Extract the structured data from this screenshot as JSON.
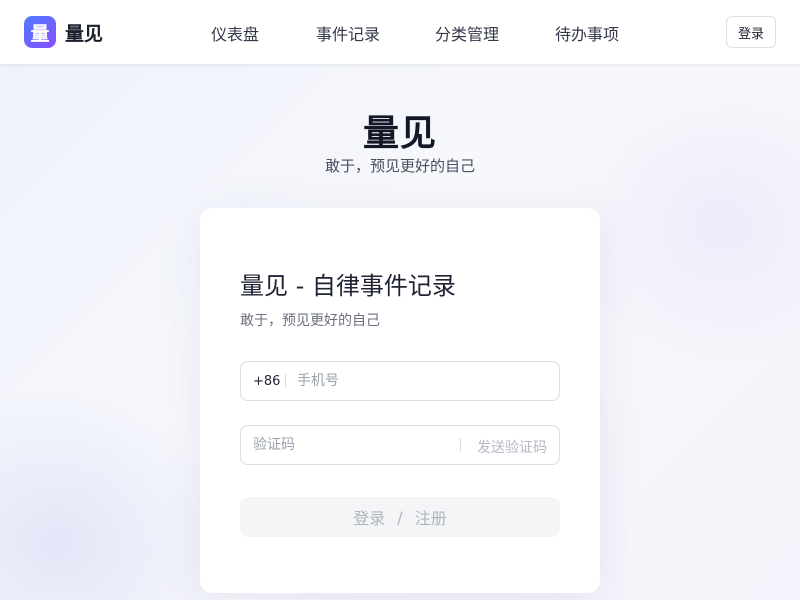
{
  "header": {
    "logo_char": "量",
    "brand_name": "量见",
    "nav": [
      "仪表盘",
      "事件记录",
      "分类管理",
      "待办事项"
    ],
    "login_label": "登录"
  },
  "hero": {
    "title": "量见",
    "subtitle": "敢于，预见更好的自己"
  },
  "card": {
    "title": "量见 - 自律事件记录",
    "subtitle": "敢于，预见更好的自己",
    "phone": {
      "prefix": "+86",
      "placeholder": "手机号",
      "value": ""
    },
    "code": {
      "placeholder": "验证码",
      "value": "",
      "send_label": "发送验证码"
    },
    "submit": {
      "login": "登录",
      "divider": "/",
      "register": "注册"
    }
  },
  "colors": {
    "brand_start": "#4f7cff",
    "brand_end": "#8a4dff"
  }
}
